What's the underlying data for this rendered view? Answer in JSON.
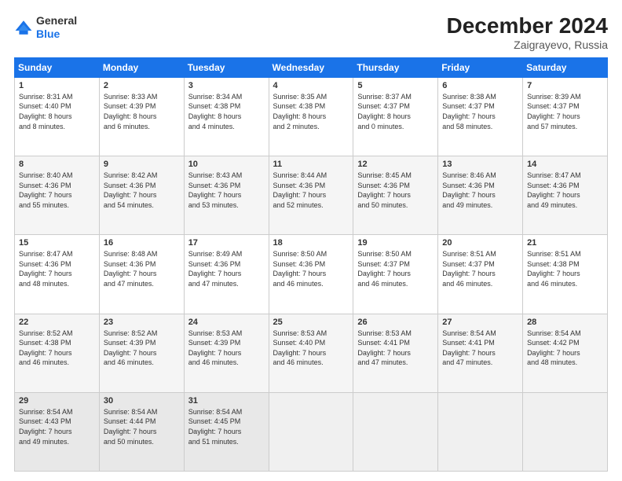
{
  "logo": {
    "line1": "General",
    "line2": "Blue"
  },
  "header": {
    "month": "December 2024",
    "location": "Zaigrayevo, Russia"
  },
  "days_of_week": [
    "Sunday",
    "Monday",
    "Tuesday",
    "Wednesday",
    "Thursday",
    "Friday",
    "Saturday"
  ],
  "weeks": [
    [
      {
        "day": "1",
        "info": "Sunrise: 8:31 AM\nSunset: 4:40 PM\nDaylight: 8 hours\nand 8 minutes."
      },
      {
        "day": "2",
        "info": "Sunrise: 8:33 AM\nSunset: 4:39 PM\nDaylight: 8 hours\nand 6 minutes."
      },
      {
        "day": "3",
        "info": "Sunrise: 8:34 AM\nSunset: 4:38 PM\nDaylight: 8 hours\nand 4 minutes."
      },
      {
        "day": "4",
        "info": "Sunrise: 8:35 AM\nSunset: 4:38 PM\nDaylight: 8 hours\nand 2 minutes."
      },
      {
        "day": "5",
        "info": "Sunrise: 8:37 AM\nSunset: 4:37 PM\nDaylight: 8 hours\nand 0 minutes."
      },
      {
        "day": "6",
        "info": "Sunrise: 8:38 AM\nSunset: 4:37 PM\nDaylight: 7 hours\nand 58 minutes."
      },
      {
        "day": "7",
        "info": "Sunrise: 8:39 AM\nSunset: 4:37 PM\nDaylight: 7 hours\nand 57 minutes."
      }
    ],
    [
      {
        "day": "8",
        "info": "Sunrise: 8:40 AM\nSunset: 4:36 PM\nDaylight: 7 hours\nand 55 minutes."
      },
      {
        "day": "9",
        "info": "Sunrise: 8:42 AM\nSunset: 4:36 PM\nDaylight: 7 hours\nand 54 minutes."
      },
      {
        "day": "10",
        "info": "Sunrise: 8:43 AM\nSunset: 4:36 PM\nDaylight: 7 hours\nand 53 minutes."
      },
      {
        "day": "11",
        "info": "Sunrise: 8:44 AM\nSunset: 4:36 PM\nDaylight: 7 hours\nand 52 minutes."
      },
      {
        "day": "12",
        "info": "Sunrise: 8:45 AM\nSunset: 4:36 PM\nDaylight: 7 hours\nand 50 minutes."
      },
      {
        "day": "13",
        "info": "Sunrise: 8:46 AM\nSunset: 4:36 PM\nDaylight: 7 hours\nand 49 minutes."
      },
      {
        "day": "14",
        "info": "Sunrise: 8:47 AM\nSunset: 4:36 PM\nDaylight: 7 hours\nand 49 minutes."
      }
    ],
    [
      {
        "day": "15",
        "info": "Sunrise: 8:47 AM\nSunset: 4:36 PM\nDaylight: 7 hours\nand 48 minutes."
      },
      {
        "day": "16",
        "info": "Sunrise: 8:48 AM\nSunset: 4:36 PM\nDaylight: 7 hours\nand 47 minutes."
      },
      {
        "day": "17",
        "info": "Sunrise: 8:49 AM\nSunset: 4:36 PM\nDaylight: 7 hours\nand 47 minutes."
      },
      {
        "day": "18",
        "info": "Sunrise: 8:50 AM\nSunset: 4:36 PM\nDaylight: 7 hours\nand 46 minutes."
      },
      {
        "day": "19",
        "info": "Sunrise: 8:50 AM\nSunset: 4:37 PM\nDaylight: 7 hours\nand 46 minutes."
      },
      {
        "day": "20",
        "info": "Sunrise: 8:51 AM\nSunset: 4:37 PM\nDaylight: 7 hours\nand 46 minutes."
      },
      {
        "day": "21",
        "info": "Sunrise: 8:51 AM\nSunset: 4:38 PM\nDaylight: 7 hours\nand 46 minutes."
      }
    ],
    [
      {
        "day": "22",
        "info": "Sunrise: 8:52 AM\nSunset: 4:38 PM\nDaylight: 7 hours\nand 46 minutes."
      },
      {
        "day": "23",
        "info": "Sunrise: 8:52 AM\nSunset: 4:39 PM\nDaylight: 7 hours\nand 46 minutes."
      },
      {
        "day": "24",
        "info": "Sunrise: 8:53 AM\nSunset: 4:39 PM\nDaylight: 7 hours\nand 46 minutes."
      },
      {
        "day": "25",
        "info": "Sunrise: 8:53 AM\nSunset: 4:40 PM\nDaylight: 7 hours\nand 46 minutes."
      },
      {
        "day": "26",
        "info": "Sunrise: 8:53 AM\nSunset: 4:41 PM\nDaylight: 7 hours\nand 47 minutes."
      },
      {
        "day": "27",
        "info": "Sunrise: 8:54 AM\nSunset: 4:41 PM\nDaylight: 7 hours\nand 47 minutes."
      },
      {
        "day": "28",
        "info": "Sunrise: 8:54 AM\nSunset: 4:42 PM\nDaylight: 7 hours\nand 48 minutes."
      }
    ],
    [
      {
        "day": "29",
        "info": "Sunrise: 8:54 AM\nSunset: 4:43 PM\nDaylight: 7 hours\nand 49 minutes."
      },
      {
        "day": "30",
        "info": "Sunrise: 8:54 AM\nSunset: 4:44 PM\nDaylight: 7 hours\nand 50 minutes."
      },
      {
        "day": "31",
        "info": "Sunrise: 8:54 AM\nSunset: 4:45 PM\nDaylight: 7 hours\nand 51 minutes."
      },
      {
        "day": "",
        "info": ""
      },
      {
        "day": "",
        "info": ""
      },
      {
        "day": "",
        "info": ""
      },
      {
        "day": "",
        "info": ""
      }
    ]
  ]
}
